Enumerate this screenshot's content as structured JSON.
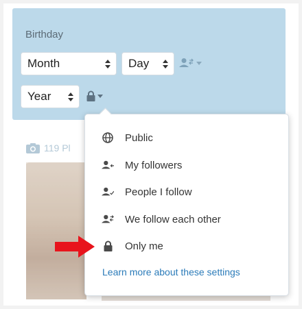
{
  "birthday": {
    "label": "Birthday",
    "month": "Month",
    "day": "Day",
    "year": "Year"
  },
  "photos": {
    "count_text": "119 Pl"
  },
  "privacy_menu": {
    "items": [
      {
        "label": "Public",
        "icon": "globe-icon"
      },
      {
        "label": "My followers",
        "icon": "followers-icon"
      },
      {
        "label": "People I follow",
        "icon": "following-icon"
      },
      {
        "label": "We follow each other",
        "icon": "mutual-follow-icon"
      },
      {
        "label": "Only me",
        "icon": "lock-icon"
      }
    ],
    "learn_more": "Learn more about these settings"
  },
  "colors": {
    "panel": "#bcd9ea",
    "link": "#2b7bb9",
    "arrow": "#e8141c",
    "icon": "#4a4a4a"
  }
}
